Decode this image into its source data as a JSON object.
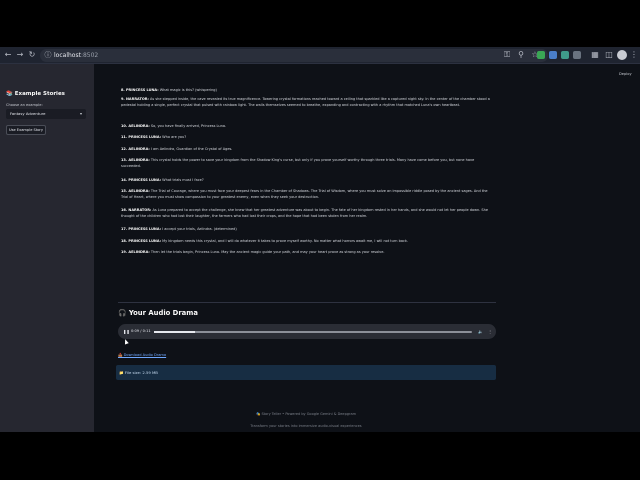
{
  "browser": {
    "url_host": "localhost",
    "url_port": ":8502",
    "back_icon": "arrow-left-icon",
    "forward_icon": "arrow-right-icon",
    "reload_icon": "reload-icon"
  },
  "header": {
    "deploy_label": "Deploy"
  },
  "sidebar": {
    "title": "📚 Example Stories",
    "choose_label": "Choose an example:",
    "selected_example": "Fantasy Adventure",
    "use_button": "Use Example Story"
  },
  "script_lines": [
    {
      "speaker": "8. PRINCESS LUNA:",
      "text": " What magic is this? (whispering)"
    },
    {
      "speaker": "9. NARRATOR:",
      "text": " As she stepped inside, the cave revealed its true magnificence. Towering crystal formations reached toward a ceiling that sparkled like a captured night sky. In the center of the chamber stood a pedestal holding a single, perfect crystal that pulsed with rainbow light. The walls themselves seemed to breathe, expanding and contracting with a rhythm that matched Luna's own heartbeat."
    },
    {
      "speaker": "10. AELINDRA:",
      "text": " So, you have finally arrived, Princess Luna."
    },
    {
      "speaker": "11. PRINCESS LUNA:",
      "text": " Who are you?"
    },
    {
      "speaker": "12. AELINDRA:",
      "text": " I am Aelindra, Guardian of the Crystal of Ages."
    },
    {
      "speaker": "13. AELINDRA:",
      "text": " This crystal holds the power to save your kingdom from the Shadow King's curse, but only if you prove yourself worthy through three trials. Many have come before you, but none have succeeded."
    },
    {
      "speaker": "14. PRINCESS LUNA:",
      "text": " What trials must I face?"
    },
    {
      "speaker": "15. AELINDRA:",
      "text": " The Trial of Courage, where you must face your deepest fears in the Chamber of Shadows. The Trial of Wisdom, where you must solve an impossible riddle posed by the ancient sages. And the Trial of Heart, where you must show compassion to your greatest enemy, even when they seek your destruction."
    },
    {
      "speaker": "16. NARRATOR:",
      "text": " As Luna prepared to accept the challenge, she knew that her greatest adventure was about to begin. The fate of her kingdom rested in her hands, and she would not let her people down. She thought of the children who had lost their laughter, the farmers who had lost their crops, and the hope that had been stolen from her realm."
    },
    {
      "speaker": "17. PRINCESS LUNA:",
      "text": " I accept your trials, Aelindra. (determined)"
    },
    {
      "speaker": "18. PRINCESS LUNA:",
      "text": " My kingdom needs this crystal, and I will do whatever it takes to prove myself worthy. No matter what horrors await me, I will not turn back."
    },
    {
      "speaker": "19. AELINDRA:",
      "text": " Then let the trials begin, Princess Luna. May the ancient magic guide your path, and may your heart prove as strong as your resolve."
    }
  ],
  "audio": {
    "section_title": "🎧 Your Audio Drama",
    "time": "0:09 / 0:11",
    "progress_fraction": 0.13,
    "download_label": "📥 Download Audio Drama",
    "file_size": "📁 File size: 2.59 MB"
  },
  "footer": {
    "credit": "🎭 Story Teller • Powered by Google Gemini & Deepgram",
    "tagline": "Transform your stories into immersive audio-visual experiences"
  }
}
